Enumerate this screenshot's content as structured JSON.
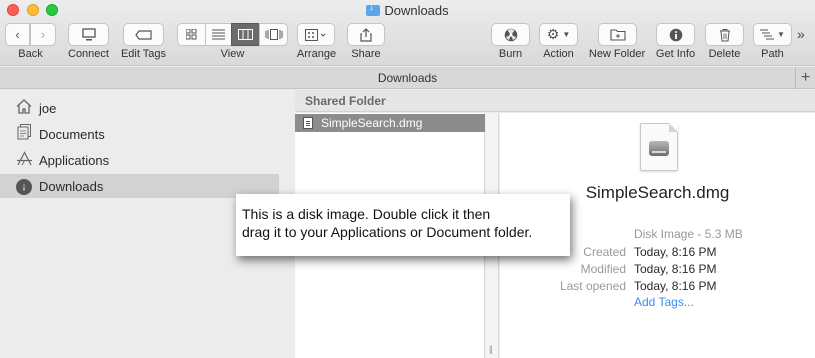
{
  "window": {
    "title": "Downloads"
  },
  "toolbar": {
    "buttons": [
      {
        "id": "back",
        "label": "Back"
      },
      {
        "id": "connect",
        "label": "Connect"
      },
      {
        "id": "edit_tags",
        "label": "Edit Tags"
      },
      {
        "id": "view",
        "label": "View"
      },
      {
        "id": "arrange",
        "label": "Arrange"
      },
      {
        "id": "share",
        "label": "Share"
      },
      {
        "id": "burn",
        "label": "Burn"
      },
      {
        "id": "action",
        "label": "Action"
      },
      {
        "id": "new_folder",
        "label": "New Folder"
      },
      {
        "id": "get_info",
        "label": "Get Info"
      },
      {
        "id": "delete",
        "label": "Delete"
      },
      {
        "id": "path",
        "label": "Path"
      }
    ],
    "view_modes": [
      "icon",
      "list",
      "column",
      "cover-flow"
    ],
    "active_view_mode": "column",
    "overflow_glyph": "»"
  },
  "pathbar": {
    "title": "Downloads",
    "add_glyph": "+"
  },
  "sidebar": {
    "items": [
      {
        "label": "joe",
        "icon": "home-icon"
      },
      {
        "label": "Documents",
        "icon": "documents-icon"
      },
      {
        "label": "Applications",
        "icon": "applications-icon"
      },
      {
        "label": "Downloads",
        "icon": "downloads-icon",
        "selected": true
      }
    ]
  },
  "browser": {
    "section_header": "Shared Folder",
    "files": [
      {
        "name": "SimpleSearch.dmg",
        "selected": true
      }
    ]
  },
  "preview": {
    "file_name": "SimpleSearch.dmg",
    "kind": "Disk Image - 5.3 MB",
    "meta": [
      {
        "key": "Created",
        "value": "Today, 8:16 PM"
      },
      {
        "key": "Modified",
        "value": "Today, 8:16 PM"
      },
      {
        "key": "Last opened",
        "value": "Today, 8:16 PM"
      }
    ],
    "add_tags_label": "Add Tags..."
  },
  "callout": {
    "line1": "This is a disk image. Double click it then",
    "line2": "drag it to your Applications or Document folder."
  },
  "colors": {
    "accent_link": "#3c8cf2",
    "close": "#fd5f57",
    "minimize": "#febc2e",
    "maximize": "#28c840",
    "selection": "#8c8c8c"
  }
}
